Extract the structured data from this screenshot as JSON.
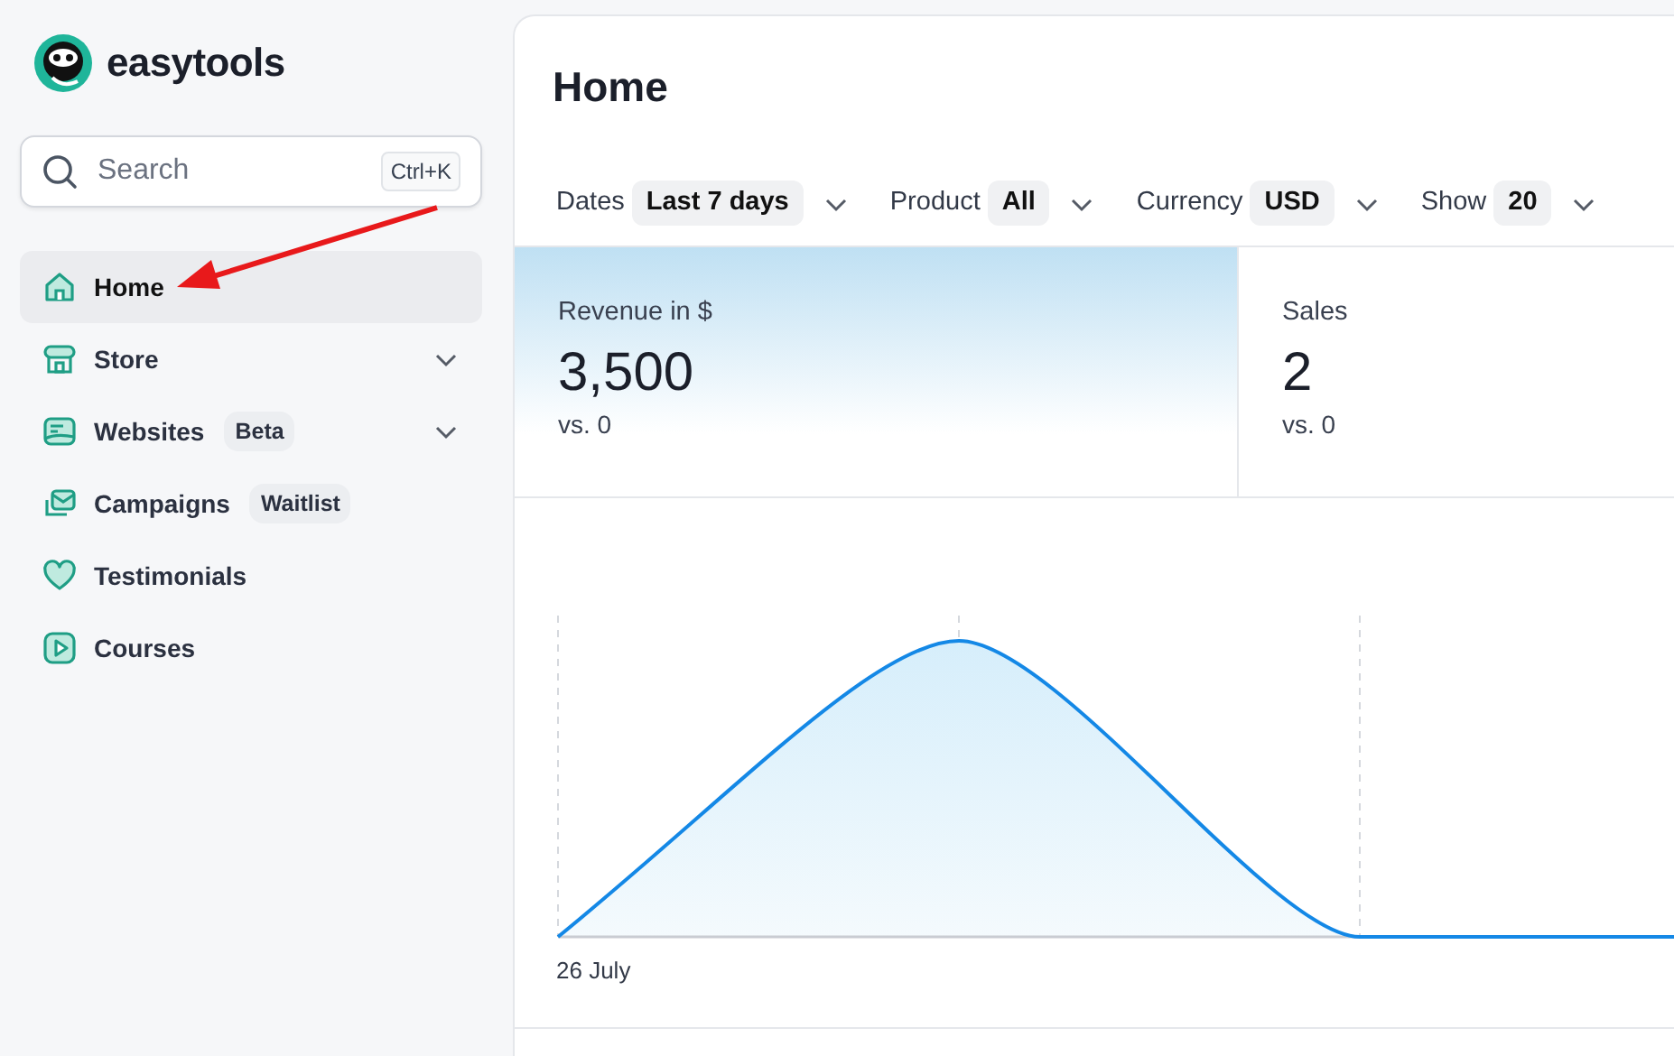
{
  "brand": {
    "name": "easytools"
  },
  "search": {
    "placeholder": "Search",
    "shortcut": "Ctrl+K"
  },
  "sidebar": {
    "items": [
      {
        "label": "Home",
        "selected": true,
        "expandable": false
      },
      {
        "label": "Store",
        "selected": false,
        "expandable": true
      },
      {
        "label": "Websites",
        "selected": false,
        "expandable": true,
        "badge": "Beta"
      },
      {
        "label": "Campaigns",
        "selected": false,
        "expandable": false,
        "badge": "Waitlist"
      },
      {
        "label": "Testimonials",
        "selected": false,
        "expandable": false
      },
      {
        "label": "Courses",
        "selected": false,
        "expandable": false
      }
    ]
  },
  "page": {
    "title": "Home"
  },
  "filters": [
    {
      "label": "Dates",
      "value": "Last 7 days"
    },
    {
      "label": "Product",
      "value": "All"
    },
    {
      "label": "Currency",
      "value": "USD"
    },
    {
      "label": "Show",
      "value": "20"
    }
  ],
  "stats": [
    {
      "label": "Revenue in $",
      "value": "3,500",
      "comparison": "vs. 0",
      "selected": true
    },
    {
      "label": "Sales",
      "value": "2",
      "comparison": "vs. 0",
      "selected": false
    }
  ],
  "chart": {
    "x_label": "26 July"
  }
}
